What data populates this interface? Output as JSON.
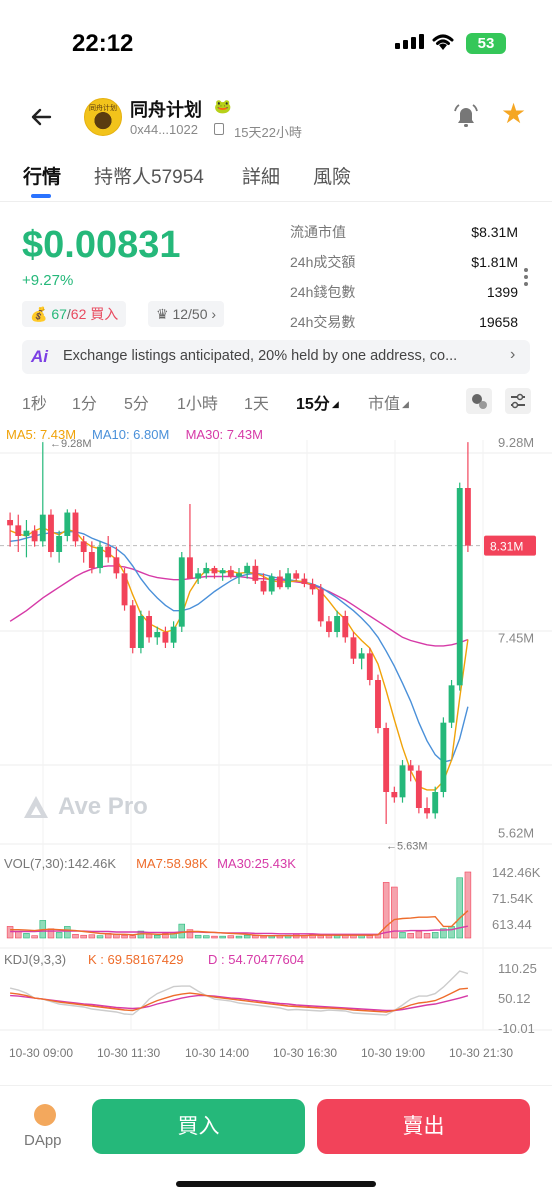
{
  "status_bar": {
    "time": "22:12",
    "battery": "53"
  },
  "token": {
    "name": "同舟计划",
    "emoji": "🐸",
    "avatar_text": "同舟计划",
    "address": "0x44...1022",
    "age": "15天22小時"
  },
  "tabs": [
    {
      "label": "行情",
      "active": true
    },
    {
      "label": "持幣人57954",
      "active": false
    },
    {
      "label": "詳細",
      "active": false
    },
    {
      "label": "風險",
      "active": false
    }
  ],
  "price": {
    "value": "$0.00831",
    "change": "+9.27%",
    "buyers_green": "67",
    "buyers_sep": "/",
    "buyers_red": "62",
    "buy_label": "買入",
    "rank": "12/50",
    "rank_chevron": "›"
  },
  "stats": [
    {
      "label": "流通市值",
      "value": "$8.31M"
    },
    {
      "label": "24h成交額",
      "value": "$1.81M"
    },
    {
      "label": "24h錢包數",
      "value": "1399"
    },
    {
      "label": "24h交易數",
      "value": "19658"
    }
  ],
  "ai_banner": {
    "badge": "Ai",
    "text": "Exchange listings anticipated, 20% held by one address, co...",
    "chevron": "›"
  },
  "timeframes": [
    {
      "label": "1秒",
      "active": false
    },
    {
      "label": "1分",
      "active": false
    },
    {
      "label": "5分",
      "active": false
    },
    {
      "label": "1小時",
      "active": false
    },
    {
      "label": "1天",
      "active": false
    },
    {
      "label": "15分",
      "active": true,
      "dropdown": true
    },
    {
      "label": "市值",
      "active": false,
      "dropdown": true
    }
  ],
  "watermark": "Ave Pro",
  "chart_data": {
    "type": "candlestick",
    "legend_ma": [
      {
        "name": "MA5: 7.43M",
        "color": "#f0a30a"
      },
      {
        "name": "MA10: 6.80M",
        "color": "#4a90d9"
      },
      {
        "name": "MA30: 7.43M",
        "color": "#d63aa7"
      }
    ],
    "y_ticks": [
      "9.28M",
      "7.45M",
      "5.62M"
    ],
    "y_ticks_values": [
      9.28,
      7.45,
      5.62
    ],
    "current_label": "8.31M",
    "current_value": 8.31,
    "high_annotation": "←9.28M",
    "low_annotation": "←5.63M",
    "ylim": [
      5.55,
      9.3
    ],
    "candles_ohlc": [
      [
        8.55,
        8.62,
        8.3,
        8.5
      ],
      [
        8.5,
        8.6,
        8.25,
        8.4
      ],
      [
        8.4,
        8.55,
        8.2,
        8.45
      ],
      [
        8.45,
        8.5,
        8.3,
        8.35
      ],
      [
        8.35,
        9.28,
        8.3,
        8.6
      ],
      [
        8.6,
        8.65,
        8.2,
        8.25
      ],
      [
        8.25,
        8.45,
        8.15,
        8.4
      ],
      [
        8.4,
        8.65,
        8.35,
        8.62
      ],
      [
        8.62,
        8.65,
        8.3,
        8.35
      ],
      [
        8.35,
        8.4,
        8.15,
        8.25
      ],
      [
        8.25,
        8.35,
        8.05,
        8.1
      ],
      [
        8.1,
        8.35,
        8.05,
        8.3
      ],
      [
        8.3,
        8.4,
        8.15,
        8.2
      ],
      [
        8.2,
        8.3,
        8.0,
        8.05
      ],
      [
        8.05,
        8.1,
        7.7,
        7.75
      ],
      [
        7.75,
        7.8,
        7.3,
        7.35
      ],
      [
        7.35,
        7.7,
        7.3,
        7.65
      ],
      [
        7.65,
        7.7,
        7.4,
        7.45
      ],
      [
        7.45,
        7.55,
        7.38,
        7.5
      ],
      [
        7.5,
        7.55,
        7.35,
        7.4
      ],
      [
        7.4,
        7.6,
        7.35,
        7.55
      ],
      [
        7.55,
        8.25,
        7.5,
        8.2
      ],
      [
        8.2,
        8.7,
        8.15,
        8.0
      ],
      [
        8.0,
        8.1,
        7.95,
        8.05
      ],
      [
        8.05,
        8.15,
        8.0,
        8.1
      ],
      [
        8.1,
        8.12,
        8.0,
        8.05
      ],
      [
        8.05,
        8.1,
        7.98,
        8.08
      ],
      [
        8.08,
        8.12,
        8.0,
        8.02
      ],
      [
        8.02,
        8.1,
        7.95,
        8.05
      ],
      [
        8.05,
        8.15,
        8.0,
        8.12
      ],
      [
        8.12,
        8.18,
        7.95,
        7.98
      ],
      [
        7.98,
        8.05,
        7.85,
        7.88
      ],
      [
        7.88,
        8.05,
        7.85,
        8.02
      ],
      [
        8.02,
        8.08,
        7.9,
        7.92
      ],
      [
        7.92,
        8.1,
        7.9,
        8.05
      ],
      [
        8.05,
        8.08,
        7.98,
        8.0
      ],
      [
        8.0,
        8.05,
        7.92,
        7.95
      ],
      [
        7.95,
        8.0,
        7.85,
        7.9
      ],
      [
        7.9,
        7.95,
        7.55,
        7.6
      ],
      [
        7.6,
        7.65,
        7.45,
        7.5
      ],
      [
        7.5,
        7.7,
        7.45,
        7.65
      ],
      [
        7.65,
        7.7,
        7.4,
        7.45
      ],
      [
        7.45,
        7.5,
        7.2,
        7.25
      ],
      [
        7.25,
        7.35,
        7.15,
        7.3
      ],
      [
        7.3,
        7.35,
        7.0,
        7.05
      ],
      [
        7.05,
        7.1,
        6.55,
        6.6
      ],
      [
        6.6,
        6.65,
        5.7,
        6.0
      ],
      [
        6.0,
        6.05,
        5.9,
        5.95
      ],
      [
        5.95,
        6.3,
        5.9,
        6.25
      ],
      [
        6.25,
        6.3,
        6.1,
        6.2
      ],
      [
        6.2,
        6.25,
        5.8,
        5.85
      ],
      [
        5.85,
        5.95,
        5.75,
        5.8
      ],
      [
        5.8,
        6.05,
        5.75,
        6.0
      ],
      [
        6.0,
        6.7,
        5.95,
        6.65
      ],
      [
        6.65,
        7.05,
        6.6,
        7.0
      ],
      [
        7.0,
        8.9,
        6.95,
        8.85
      ],
      [
        8.85,
        9.28,
        8.25,
        8.31
      ]
    ],
    "ma5": [
      8.45,
      8.42,
      8.4,
      8.45,
      8.48,
      8.44,
      8.41,
      8.46,
      8.44,
      8.35,
      8.3,
      8.28,
      8.24,
      8.18,
      8.05,
      7.85,
      7.67,
      7.58,
      7.54,
      7.5,
      7.52,
      7.66,
      7.88,
      8.0,
      8.08,
      8.08,
      8.06,
      8.07,
      8.05,
      8.06,
      8.05,
      8.02,
      7.98,
      7.97,
      7.97,
      7.98,
      7.97,
      7.94,
      7.88,
      7.79,
      7.69,
      7.62,
      7.5,
      7.42,
      7.35,
      7.2,
      6.95,
      6.68,
      6.42,
      6.2,
      6.05,
      6.02,
      6.02,
      6.1,
      6.3,
      6.88,
      7.43
    ],
    "ma10": [
      8.35,
      8.36,
      8.38,
      8.4,
      8.42,
      8.43,
      8.43,
      8.44,
      8.44,
      8.42,
      8.38,
      8.35,
      8.32,
      8.28,
      8.22,
      8.12,
      8.0,
      7.9,
      7.82,
      7.75,
      7.7,
      7.7,
      7.72,
      7.76,
      7.82,
      7.88,
      7.93,
      7.98,
      8.02,
      8.04,
      8.05,
      8.04,
      8.02,
      8.0,
      7.99,
      7.98,
      7.97,
      7.95,
      7.92,
      7.87,
      7.82,
      7.76,
      7.7,
      7.63,
      7.55,
      7.45,
      7.32,
      7.18,
      7.02,
      6.85,
      6.65,
      6.48,
      6.35,
      6.28,
      6.3,
      6.5,
      6.8
    ],
    "ma30": [
      7.6,
      7.65,
      7.7,
      7.76,
      7.82,
      7.87,
      7.92,
      7.97,
      8.02,
      8.06,
      8.09,
      8.11,
      8.12,
      8.12,
      8.11,
      8.09,
      8.06,
      8.03,
      8.01,
      8.0,
      7.99,
      7.99,
      8.0,
      8.01,
      8.02,
      8.02,
      8.02,
      8.02,
      8.02,
      8.01,
      8.0,
      8.0,
      7.99,
      7.99,
      7.98,
      7.97,
      7.96,
      7.94,
      7.91,
      7.88,
      7.84,
      7.8,
      7.75,
      7.7,
      7.65,
      7.6,
      7.55,
      7.5,
      7.45,
      7.42,
      7.4,
      7.38,
      7.37,
      7.37,
      7.38,
      7.4,
      7.43
    ],
    "volume_legend": [
      {
        "name": "VOL(7,30):142.46K",
        "color": "#777"
      },
      {
        "name": "MA7:58.98K",
        "color": "#ee6c2b"
      },
      {
        "name": "MA30:25.43K",
        "color": "#d63aa7"
      }
    ],
    "volume_ticks": [
      "142.46K",
      "71.54K",
      "613.44"
    ],
    "volume_k": [
      25,
      14,
      10,
      5,
      38,
      20,
      12,
      25,
      8,
      6,
      7,
      5,
      10,
      8,
      6,
      5,
      15,
      8,
      6,
      10,
      12,
      30,
      18,
      6,
      5,
      4,
      4,
      5,
      4,
      6,
      5,
      4,
      4,
      5,
      6,
      8,
      6,
      7,
      5,
      6,
      5,
      8,
      6,
      8,
      5,
      8,
      120,
      110,
      12,
      10,
      14,
      10,
      12,
      20,
      25,
      130,
      142.46
    ],
    "vol_ma7_k": [
      18,
      18,
      17,
      16,
      18,
      19,
      18,
      17,
      16,
      14,
      12,
      10,
      9,
      8,
      8,
      7,
      9,
      9,
      8,
      8,
      9,
      12,
      14,
      14,
      13,
      12,
      11,
      10,
      9,
      8,
      6,
      5,
      5,
      5,
      5,
      5,
      5,
      6,
      6,
      6,
      6,
      6,
      6,
      6,
      6,
      7,
      25,
      40,
      42,
      43,
      45,
      45,
      46,
      25,
      25,
      43,
      58.98
    ],
    "vol_ma30_k": [
      14,
      14,
      14,
      14,
      15,
      15,
      15,
      15,
      15,
      15,
      14,
      14,
      14,
      13,
      13,
      13,
      13,
      12,
      12,
      12,
      12,
      13,
      13,
      13,
      12,
      12,
      11,
      11,
      11,
      11,
      10,
      10,
      10,
      9,
      9,
      9,
      9,
      9,
      8,
      8,
      8,
      8,
      8,
      8,
      8,
      8,
      12,
      15,
      15,
      16,
      16,
      16,
      17,
      17,
      18,
      22,
      25.43
    ],
    "kdj_legend": [
      {
        "name": "KDJ(9,3,3)",
        "color": "#777"
      },
      {
        "name": "K : 69.58167429",
        "color": "#ee6c2b"
      },
      {
        "name": "D : 54.70477604",
        "color": "#d63aa7"
      }
    ],
    "kdj_ticks": [
      "110.25",
      "50.12",
      "-10.01"
    ],
    "kdj_k": [
      60,
      58,
      55,
      50,
      48,
      45,
      42,
      40,
      38,
      36,
      34,
      32,
      30,
      28,
      26,
      25,
      30,
      38,
      45,
      50,
      55,
      58,
      60,
      58,
      55,
      52,
      50,
      48,
      46,
      44,
      42,
      40,
      38,
      36,
      34,
      33,
      32,
      31,
      30,
      30,
      29,
      28,
      26,
      25,
      24,
      23,
      22,
      25,
      30,
      36,
      40,
      42,
      45,
      52,
      60,
      68,
      69.58
    ],
    "kdj_d": [
      55,
      54,
      52,
      50,
      48,
      46,
      44,
      42,
      40,
      38,
      37,
      35,
      33,
      31,
      30,
      29,
      30,
      33,
      38,
      42,
      46,
      50,
      53,
      55,
      55,
      54,
      52,
      50,
      49,
      47,
      45,
      43,
      41,
      39,
      38,
      36,
      35,
      34,
      33,
      32,
      31,
      30,
      29,
      28,
      27,
      26,
      25,
      25,
      27,
      30,
      33,
      36,
      38,
      42,
      46,
      50,
      54.7
    ],
    "kdj_j": [
      70,
      66,
      60,
      50,
      48,
      43,
      38,
      36,
      34,
      32,
      28,
      26,
      24,
      22,
      18,
      17,
      30,
      48,
      59,
      66,
      73,
      74,
      74,
      64,
      55,
      48,
      46,
      44,
      40,
      38,
      36,
      34,
      32,
      30,
      26,
      27,
      26,
      25,
      24,
      26,
      25,
      24,
      20,
      19,
      18,
      17,
      16,
      25,
      36,
      48,
      54,
      54,
      59,
      72,
      88,
      104,
      99
    ],
    "x_ticks": [
      "10-30 09:00",
      "10-30 11:30",
      "10-30 14:00",
      "10-30 16:30",
      "10-30 19:00",
      "10-30 21:30"
    ],
    "colors": {
      "up": "#25b87a",
      "down": "#f2435a"
    }
  },
  "bottom_bar": {
    "dapp_label": "DApp",
    "buy_label": "買入",
    "sell_label": "賣出"
  }
}
